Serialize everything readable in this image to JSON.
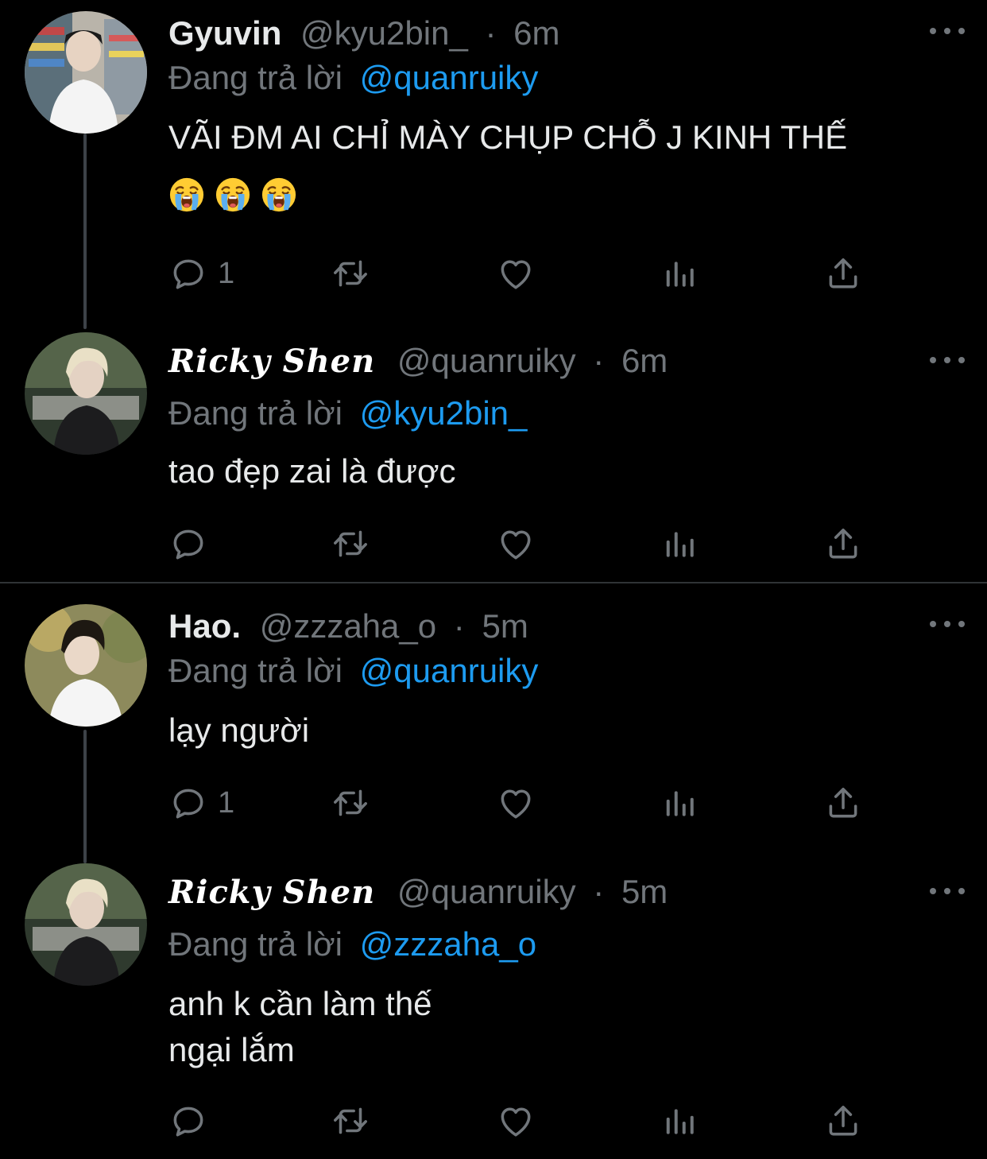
{
  "tweets": [
    {
      "name": "Gyuvin",
      "handle": "@kyu2bin_",
      "separator": "·",
      "time": "6m",
      "replying_prefix": "Đang trả lời",
      "replying_to": "@quanruiky",
      "text": "VÃI ĐM AI CHỈ MÀY CHỤP CHỖ J KINH THẾ",
      "emojis": [
        "loudly-crying-face",
        "loudly-crying-face",
        "loudly-crying-face"
      ],
      "reply_count": "1"
    },
    {
      "name": "Ricky Shen",
      "handle": "@quanruiky",
      "separator": "·",
      "time": "6m",
      "replying_prefix": "Đang trả lời",
      "replying_to": "@kyu2bin_",
      "text": "tao đẹp zai là được",
      "reply_count": ""
    },
    {
      "name": "Hao.",
      "handle": "@zzzaha_o",
      "separator": "·",
      "time": "5m",
      "replying_prefix": "Đang trả lời",
      "replying_to": "@quanruiky",
      "text": "lạy người",
      "reply_count": "1"
    },
    {
      "name": "Ricky Shen",
      "handle": "@quanruiky",
      "separator": "·",
      "time": "5m",
      "replying_prefix": "Đang trả lời",
      "replying_to": "@zzzaha_o",
      "text_line1": "anh k cần làm thế",
      "text_line2": "ngại lắm",
      "reply_count": ""
    }
  ],
  "colors": {
    "background": "#000000",
    "text": "#e7e9ea",
    "muted": "#71767b",
    "accent": "#1d9bf0",
    "divider": "#2f3336"
  },
  "icons": [
    "reply-icon",
    "retweet-icon",
    "like-icon",
    "views-icon",
    "share-icon",
    "more-icon"
  ]
}
